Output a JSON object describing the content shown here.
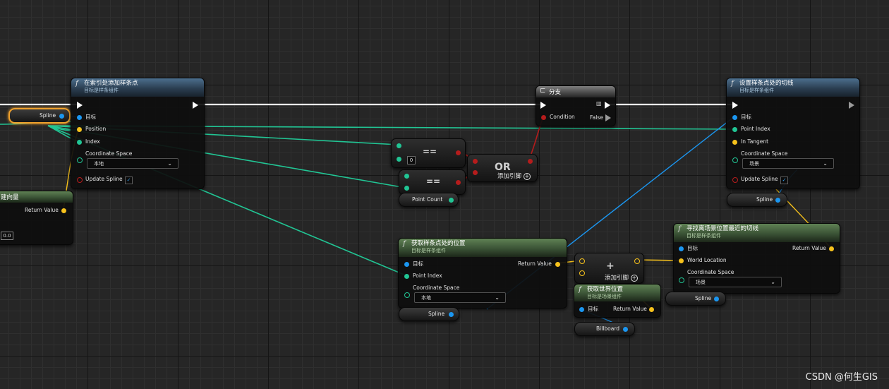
{
  "nodes": {
    "add_point": {
      "title": "在索引处添加样条点",
      "subtitle": "目标是样条组件",
      "pins": [
        "目标",
        "Position",
        "Index"
      ],
      "coordinate_space_label": "Coordinate Space",
      "coordinate_space_value": "本地",
      "update_spline_label": "Update Spline"
    },
    "branch": {
      "title": "分支",
      "condition_label": "Condition",
      "false_label": "False"
    },
    "set_tangent": {
      "title": "设置样条点处的切线",
      "subtitle": "目标是样条组件",
      "pins": [
        "目标",
        "Point Index",
        "In Tangent"
      ],
      "coordinate_space_label": "Coordinate Space",
      "coordinate_space_value": "场景",
      "update_spline_label": "Update Spline"
    },
    "find_tangent": {
      "title": "寻找离场景位置最近的切线",
      "subtitle": "目标是样条组件",
      "pins": [
        "目标",
        "World Location"
      ],
      "return_label": "Return Value",
      "coordinate_space_label": "Coordinate Space",
      "coordinate_space_value": "场景"
    },
    "get_location": {
      "title": "获取样条点处的位置",
      "subtitle": "目标是样条组件",
      "pins": [
        "目标",
        "Point Index"
      ],
      "return_label": "Return Value",
      "coordinate_space_label": "Coordinate Space",
      "coordinate_space_value": "本地"
    },
    "world_location": {
      "title": "获取世界位置",
      "subtitle": "目标是场景组件",
      "target_label": "目标",
      "return_label": "Return Value"
    },
    "left_partial": {
      "title": "建向量",
      "return_label": "Return Value",
      "value": "0.0"
    },
    "equal_a": {
      "symbol": "==",
      "default_value": "0"
    },
    "equal_b": {
      "symbol": "=="
    },
    "or_node": {
      "symbol": "OR",
      "add_pin_label": "添加引脚"
    },
    "add_vec": {
      "symbol": "+",
      "add_pin_label": "添加引脚"
    }
  },
  "variables": {
    "spline_selected": "Spline",
    "spline_set": "Spline",
    "spline_find": "Spline",
    "spline_get": "Spline",
    "point_count": "Point Count",
    "billboard": "Billboard"
  },
  "colors": {
    "exec_wire": "#ffffff",
    "object_wire": "#1b96f0",
    "vector_wire": "#f7c21c",
    "int_wire": "#21c594",
    "bool_wire": "#b51c1c",
    "function_header": "#3a5a78",
    "pure_function_header": "#4e6d45",
    "selection_outline": "#f0a12c"
  },
  "watermark": "CSDN @何生GIS"
}
